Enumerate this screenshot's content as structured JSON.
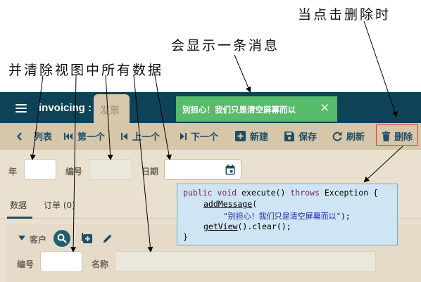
{
  "annotations": {
    "clear_views": "并清除视图中所有数据",
    "show_message": "会显示一条消息",
    "on_delete": "当点击删除时"
  },
  "header": {
    "title": "invoicing :",
    "tab": "发票"
  },
  "toast": {
    "message": "别担心！我们只是清空屏幕而以"
  },
  "toolbar": {
    "list": "列表",
    "first": "第一个",
    "prev": "上一个",
    "next": "下一个",
    "new": "新建",
    "save": "保存",
    "refresh": "刷新",
    "delete": "删除"
  },
  "form": {
    "year_label": "年",
    "number_label": "编号",
    "date_label": "日期",
    "tab_data": "数据",
    "tab_orders": "订单 (0)",
    "customer_label": "客户",
    "customer_number_label": "编号",
    "customer_name_label": "名称"
  },
  "code": {
    "line1_kw": "public void",
    "line1_rest": " execute() ",
    "line1_throws": "throws",
    "line1_end": " Exception {",
    "line2_call": "addMessage",
    "line2_paren": "(",
    "line3_str": "\"别担心！我们只是清空屏幕而以\"",
    "line3_end": ");",
    "line4_call": "getView",
    "line4_end": "().clear();",
    "line5": "}"
  },
  "colors": {
    "header": "#0e4257",
    "toolbar": "#d6c6aa",
    "toast": "#56bb6a",
    "accent": "#1f4f66",
    "delete_highlight": "#e23a3a"
  }
}
